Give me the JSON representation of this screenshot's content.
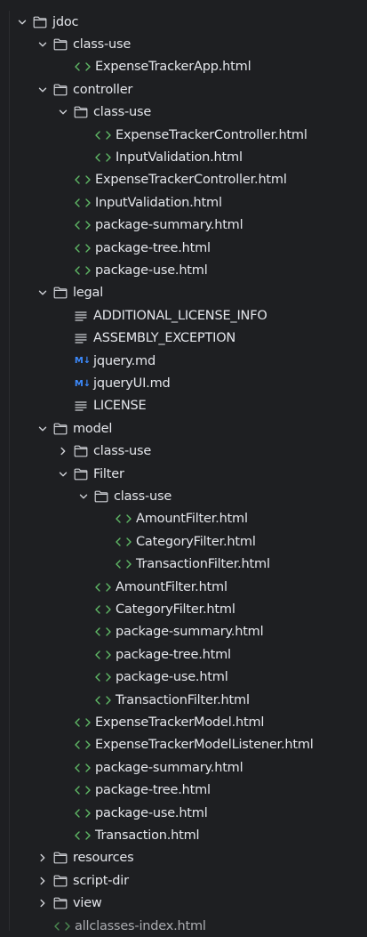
{
  "project_tree": {
    "items": [
      {
        "label": "jdoc",
        "type": "folder",
        "depth": 0,
        "expanded": true
      },
      {
        "label": "class-use",
        "type": "folder",
        "depth": 1,
        "expanded": true
      },
      {
        "label": "ExpenseTrackerApp.html",
        "type": "html",
        "depth": 2
      },
      {
        "label": "controller",
        "type": "folder",
        "depth": 1,
        "expanded": true
      },
      {
        "label": "class-use",
        "type": "folder",
        "depth": 2,
        "expanded": true
      },
      {
        "label": "ExpenseTrackerController.html",
        "type": "html",
        "depth": 3
      },
      {
        "label": "InputValidation.html",
        "type": "html",
        "depth": 3
      },
      {
        "label": "ExpenseTrackerController.html",
        "type": "html",
        "depth": 2
      },
      {
        "label": "InputValidation.html",
        "type": "html",
        "depth": 2
      },
      {
        "label": "package-summary.html",
        "type": "html",
        "depth": 2
      },
      {
        "label": "package-tree.html",
        "type": "html",
        "depth": 2
      },
      {
        "label": "package-use.html",
        "type": "html",
        "depth": 2
      },
      {
        "label": "legal",
        "type": "folder",
        "depth": 1,
        "expanded": true
      },
      {
        "label": "ADDITIONAL_LICENSE_INFO",
        "type": "text",
        "depth": 2
      },
      {
        "label": "ASSEMBLY_EXCEPTION",
        "type": "text",
        "depth": 2
      },
      {
        "label": "jquery.md",
        "type": "md",
        "depth": 2
      },
      {
        "label": "jqueryUI.md",
        "type": "md",
        "depth": 2
      },
      {
        "label": "LICENSE",
        "type": "text",
        "depth": 2
      },
      {
        "label": "model",
        "type": "folder",
        "depth": 1,
        "expanded": true
      },
      {
        "label": "class-use",
        "type": "folder",
        "depth": 2,
        "expanded": false
      },
      {
        "label": "Filter",
        "type": "folder",
        "depth": 2,
        "expanded": true
      },
      {
        "label": "class-use",
        "type": "folder",
        "depth": 3,
        "expanded": true
      },
      {
        "label": "AmountFilter.html",
        "type": "html",
        "depth": 4
      },
      {
        "label": "CategoryFilter.html",
        "type": "html",
        "depth": 4
      },
      {
        "label": "TransactionFilter.html",
        "type": "html",
        "depth": 4
      },
      {
        "label": "AmountFilter.html",
        "type": "html",
        "depth": 3
      },
      {
        "label": "CategoryFilter.html",
        "type": "html",
        "depth": 3
      },
      {
        "label": "package-summary.html",
        "type": "html",
        "depth": 3
      },
      {
        "label": "package-tree.html",
        "type": "html",
        "depth": 3
      },
      {
        "label": "package-use.html",
        "type": "html",
        "depth": 3
      },
      {
        "label": "TransactionFilter.html",
        "type": "html",
        "depth": 3
      },
      {
        "label": "ExpenseTrackerModel.html",
        "type": "html",
        "depth": 2
      },
      {
        "label": "ExpenseTrackerModelListener.html",
        "type": "html",
        "depth": 2
      },
      {
        "label": "package-summary.html",
        "type": "html",
        "depth": 2
      },
      {
        "label": "package-tree.html",
        "type": "html",
        "depth": 2
      },
      {
        "label": "package-use.html",
        "type": "html",
        "depth": 2
      },
      {
        "label": "Transaction.html",
        "type": "html",
        "depth": 2
      },
      {
        "label": "resources",
        "type": "folder",
        "depth": 1,
        "expanded": false
      },
      {
        "label": "script-dir",
        "type": "folder",
        "depth": 1,
        "expanded": false
      },
      {
        "label": "view",
        "type": "folder",
        "depth": 1,
        "expanded": false
      },
      {
        "label": "allclasses-index.html",
        "type": "html",
        "depth": 1
      }
    ]
  },
  "icons": {
    "folder": "folder-icon",
    "html": "html-file-icon",
    "text": "text-file-icon",
    "md": "markdown-file-icon",
    "expanded": "chevron-down-icon",
    "collapsed": "chevron-right-icon"
  },
  "icon_text": {
    "md": "M↓"
  },
  "colors": {
    "background": "#1e1f22",
    "text": "#e4e6eb",
    "html_icon": "#5fb866",
    "md_icon": "#3d8bff",
    "icon_gray": "#cfd1d6"
  }
}
